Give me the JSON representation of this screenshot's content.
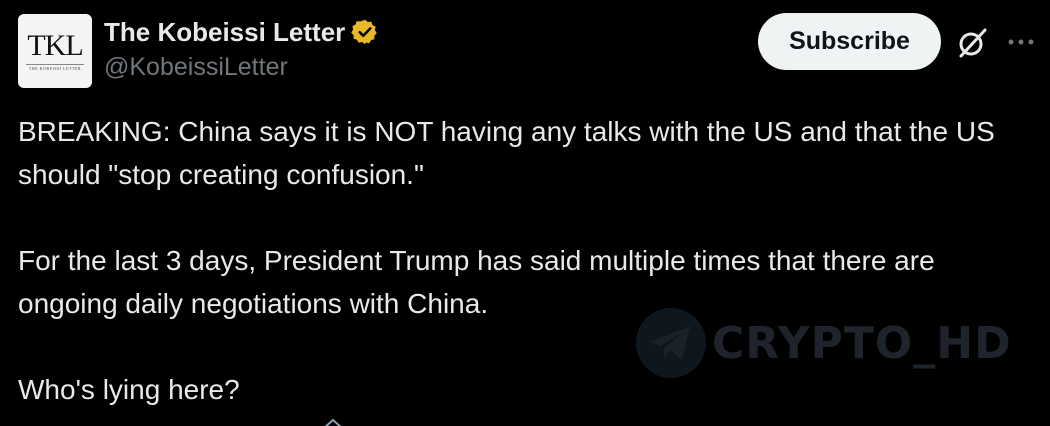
{
  "author": {
    "display_name": "The Kobeissi Letter",
    "handle": "@KobeissiLetter",
    "avatar_monogram": "TKL",
    "avatar_subtitle": "THE KOBEISSI LETTER",
    "verified_badge_color": "#e8b829"
  },
  "actions": {
    "subscribe_label": "Subscribe",
    "grok_icon": "grok-icon",
    "more_icon": "more-icon"
  },
  "post": {
    "paragraphs": [
      "BREAKING: China says it is NOT having any talks with the US and that the US should \"stop creating confusion.\"",
      "For the last 3 days, President Trump has said multiple times that there are ongoing daily negotiations with China.",
      "Who's lying here?"
    ]
  },
  "watermark": {
    "text": "CRYPTO_HD",
    "icon": "telegram-icon"
  },
  "colors": {
    "background": "#000000",
    "text_primary": "#e7e9ea",
    "text_secondary": "#71767b",
    "button_bg": "#eff3f4",
    "button_text": "#0f1419"
  }
}
